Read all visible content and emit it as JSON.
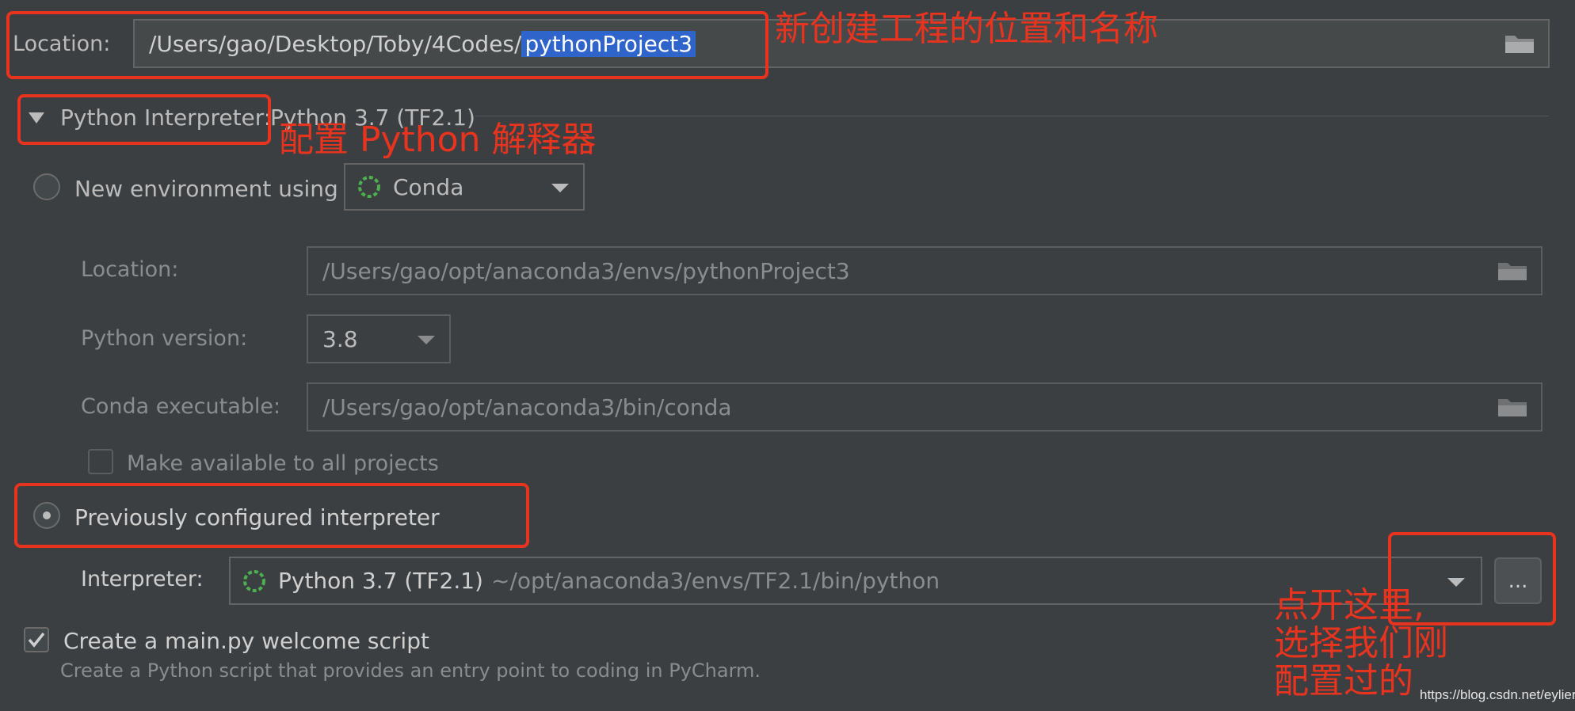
{
  "project_location": {
    "label": "Location:",
    "path_prefix": "/Users/gao/Desktop/Toby/4Codes/",
    "path_selected": "pythonProject3"
  },
  "interpreter_section": {
    "title": "Python Interpreter:",
    "value": "Python 3.7 (TF2.1)"
  },
  "new_env": {
    "radio_label": "New environment using",
    "selected": false,
    "env_tool": "Conda",
    "location_label": "Location:",
    "location_value": "/Users/gao/opt/anaconda3/envs/pythonProject3",
    "version_label": "Python version:",
    "version_value": "3.8",
    "conda_label": "Conda executable:",
    "conda_value": "/Users/gao/opt/anaconda3/bin/conda",
    "make_available_label": "Make available to all projects",
    "make_available_checked": false
  },
  "previous_interpreter": {
    "radio_label": "Previously configured interpreter",
    "selected": true,
    "interpreter_label": "Interpreter:",
    "interpreter_name": "Python 3.7 (TF2.1)",
    "interpreter_path": "~/opt/anaconda3/envs/TF2.1/bin/python",
    "more_button": "..."
  },
  "create_main": {
    "label": "Create a main.py welcome script",
    "checked": true,
    "description": "Create a Python script that provides an entry point to coding in PyCharm."
  },
  "annotations": {
    "location_note": "新创建工程的位置和名称",
    "interpreter_note": "配置 Python 解释器",
    "more_note_line1": "点开这里,",
    "more_note_line2": "选择我们刚",
    "more_note_line3": "配置过的"
  },
  "watermark": "https://blog.csdn.net/eylier",
  "colors": {
    "background": "#3c3f41",
    "annotation_red": "#e8331f",
    "selection_blue": "#2f65ca",
    "conda_green": "#4caf50"
  },
  "icons": [
    "folder-icon",
    "conda-icon",
    "chevron-down-icon",
    "checkmark-icon",
    "collapse-triangle-icon"
  ]
}
